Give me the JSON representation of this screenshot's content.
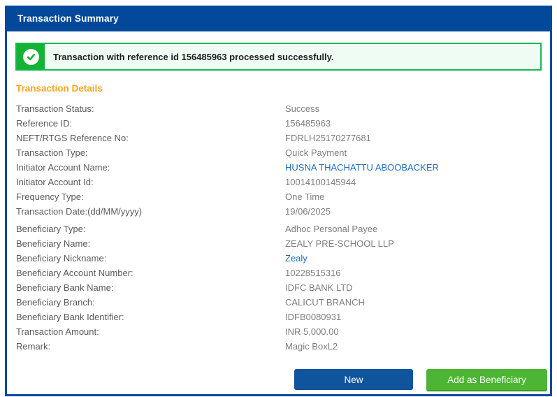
{
  "window": {
    "title": "Transaction Summary"
  },
  "banner": {
    "icon": "check-circle-icon",
    "message": "Transaction with reference id 156485963 processed successfully."
  },
  "section": {
    "title": "Transaction Details"
  },
  "details": {
    "group1": [
      {
        "label": "Transaction Status:",
        "value": "Success"
      },
      {
        "label": "Reference ID:",
        "value": "156485963"
      },
      {
        "label": "NEFT/RTGS Reference No:",
        "value": "FDRLH25170277681"
      },
      {
        "label": "Transaction Type:",
        "value": "Quick Payment"
      },
      {
        "label": "Initiator Account Name:",
        "value": "HUSNA THACHATTU ABOOBACKER"
      },
      {
        "label": "Initiator Account Id:",
        "value": "10014100145944"
      },
      {
        "label": "Frequency Type:",
        "value": "One Time"
      },
      {
        "label": "Transaction Date:(dd/MM/yyyy)",
        "value": "19/06/2025"
      }
    ],
    "group2": [
      {
        "label": "Beneficiary Type:",
        "value": "Adhoc Personal Payee"
      },
      {
        "label": "Beneficiary Name:",
        "value": "ZEALY PRE-SCHOOL LLP"
      },
      {
        "label": "Beneficiary Nickname:",
        "value": "Zealy"
      },
      {
        "label": "Beneficiary Account Number:",
        "value": "10228515316"
      },
      {
        "label": "Beneficiary Bank Name:",
        "value": "IDFC BANK LTD"
      },
      {
        "label": "Beneficiary Branch:",
        "value": "CALICUT BRANCH"
      },
      {
        "label": "Beneficiary Bank Identifier:",
        "value": "IDFB0080931"
      },
      {
        "label": "Transaction Amount:",
        "value": "INR 5,000.00"
      },
      {
        "label": "Remark:",
        "value": "Magic BoxL2"
      }
    ]
  },
  "buttons": {
    "new": "New",
    "add_beneficiary": "Add as Beneficiary"
  },
  "colors": {
    "primary_blue": "#02489B",
    "button_blue": "#0F549D",
    "success_green": "#14B235",
    "banner_border_green": "#1AB650",
    "banner_bg_green": "#EFFCF4",
    "button_green": "#4DB533",
    "heading_orange": "#FEA31E",
    "link_blue": "#1E6DC0"
  }
}
